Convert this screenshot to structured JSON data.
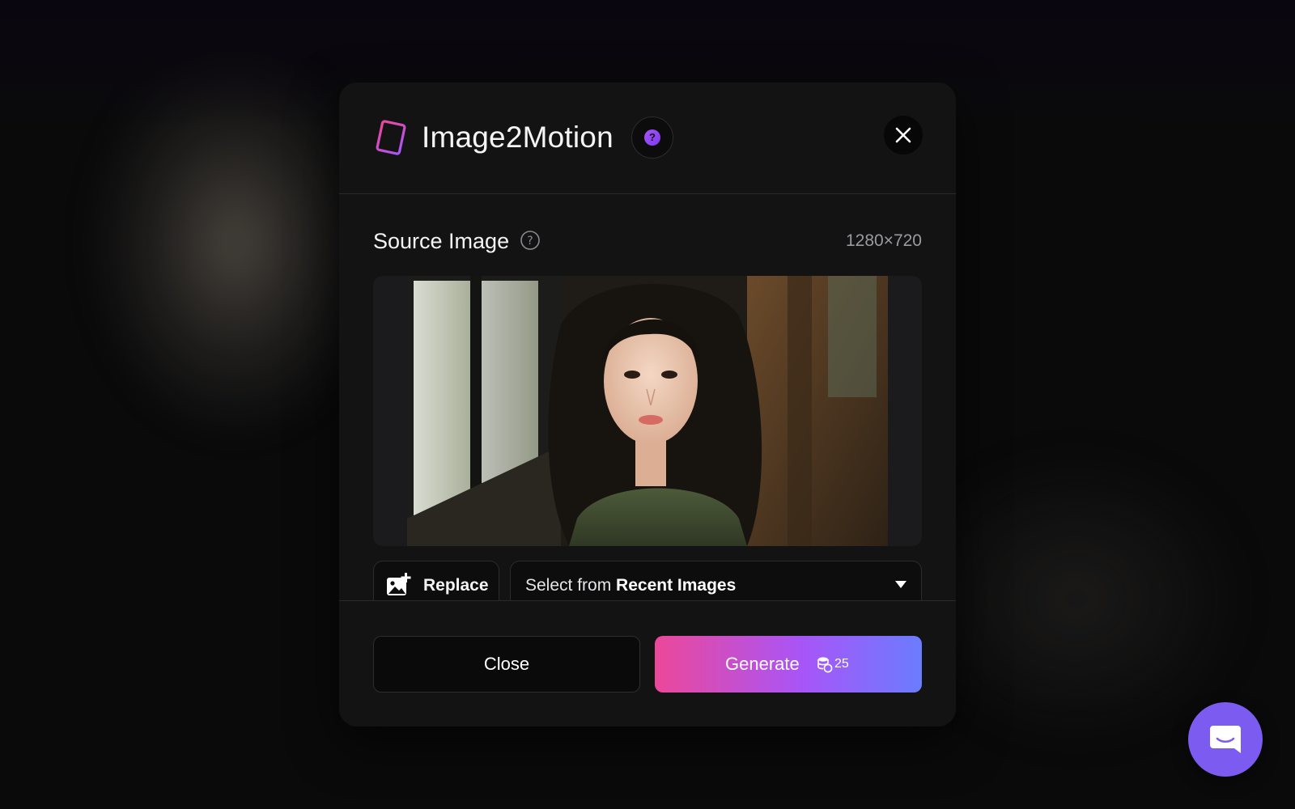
{
  "modal": {
    "title": "Image2Motion",
    "help_badge": "?",
    "source_section": {
      "title": "Source Image",
      "dimensions": "1280×720"
    },
    "replace_button": {
      "label": "Replace"
    },
    "recent_select": {
      "prefix": "Select from ",
      "emphasis": "Recent Images"
    },
    "footer": {
      "close_label": "Close",
      "generate_label": "Generate",
      "generate_cost": "25"
    }
  },
  "icons": {
    "app": "film-strip-icon",
    "help": "help-icon",
    "close": "close-icon",
    "info": "info-icon",
    "replace": "image-add-icon",
    "dropdown": "caret-down-icon",
    "coins": "coins-icon",
    "chat": "chat-icon"
  },
  "colors": {
    "accent_gradient_start": "#ec4899",
    "accent_gradient_mid": "#a855f7",
    "accent_gradient_end": "#6b7cff",
    "chat_fab": "#7c5cf0",
    "modal_bg": "#131314"
  }
}
